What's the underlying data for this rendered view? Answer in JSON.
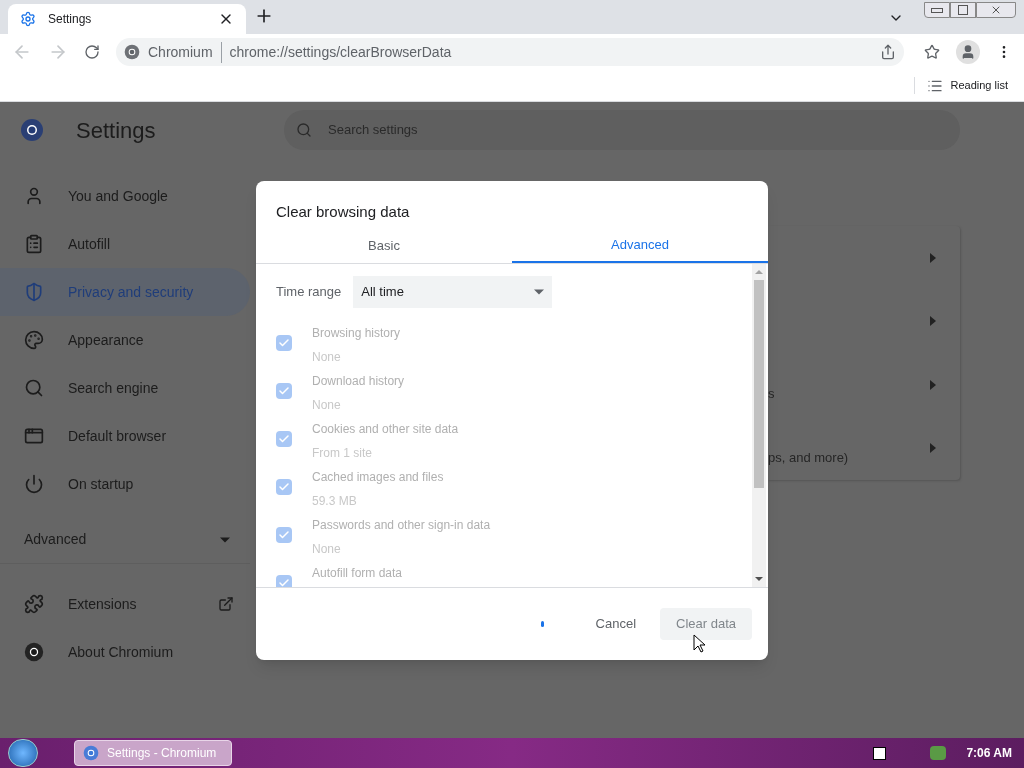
{
  "browser": {
    "tab": {
      "title": "Settings",
      "selected": true
    },
    "address": {
      "site": "Chromium",
      "url": "chrome://settings/clearBrowserData"
    },
    "bookmarks": {
      "reading_list": "Reading list"
    }
  },
  "settings": {
    "title": "Settings",
    "search": {
      "placeholder": "Search settings"
    },
    "sidebar": {
      "items": [
        {
          "label": "You and Google",
          "selected": false
        },
        {
          "label": "Autofill",
          "selected": false
        },
        {
          "label": "Privacy and security",
          "selected": true
        },
        {
          "label": "Appearance",
          "selected": false
        },
        {
          "label": "Search engine",
          "selected": false
        },
        {
          "label": "Default browser",
          "selected": false
        },
        {
          "label": "On startup",
          "selected": false
        }
      ],
      "advanced": {
        "label": "Advanced",
        "expanded": false
      },
      "extra_items": [
        {
          "label": "Extensions",
          "external": true
        },
        {
          "label": "About Chromium",
          "external": false
        }
      ]
    },
    "card_rows": [
      {
        "kind": "arrow"
      },
      {
        "kind": "arrow"
      },
      {
        "kind": "arrow",
        "text": "s"
      },
      {
        "kind": "arrow",
        "text": "ps, and more)"
      }
    ]
  },
  "dialog": {
    "title": "Clear browsing data",
    "tabs": [
      {
        "label": "Basic",
        "selected": false
      },
      {
        "label": "Advanced",
        "selected": true
      }
    ],
    "time_range": {
      "label": "Time range",
      "value": "All time"
    },
    "options": [
      {
        "label": "Browsing history",
        "detail": "None",
        "checked": true,
        "disabled": true
      },
      {
        "label": "Download history",
        "detail": "None",
        "checked": true,
        "disabled": true
      },
      {
        "label": "Cookies and other site data",
        "detail": "From 1 site",
        "checked": true,
        "disabled": true
      },
      {
        "label": "Cached images and files",
        "detail": "59.3 MB",
        "checked": true,
        "disabled": true
      },
      {
        "label": "Passwords and other sign-in data",
        "detail": "None",
        "checked": true,
        "disabled": true
      },
      {
        "label": "Autofill form data",
        "checked": true,
        "disabled": true
      }
    ],
    "busy": true,
    "buttons": [
      {
        "label": "Cancel",
        "kind": "secondary",
        "disabled": false
      },
      {
        "label": "Clear data",
        "kind": "primary",
        "disabled": true
      }
    ]
  },
  "taskbar": {
    "window": "Settings - Chromium",
    "time": "7:06 AM"
  }
}
